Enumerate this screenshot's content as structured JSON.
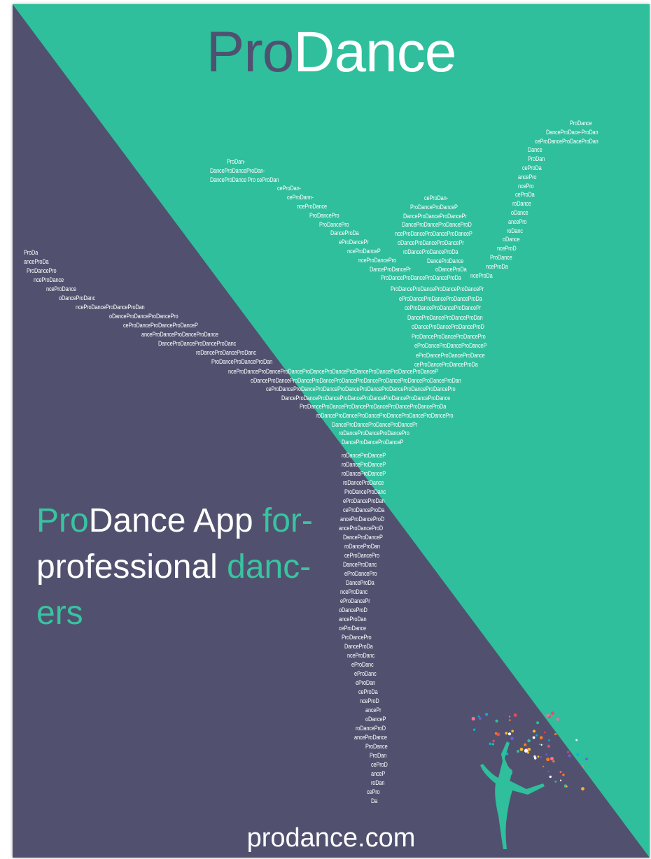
{
  "brand": {
    "part1": "Pro",
    "part2": "Dance"
  },
  "tagline": {
    "line1_a": "Pro",
    "line1_b": "Dance App ",
    "line1_c": "for-",
    "line2_a": "professional ",
    "line2_b": "danc-",
    "line3": "ers"
  },
  "url": "prodance.com",
  "colors": {
    "teal": "#2fbf9c",
    "navy": "#51516f",
    "accent": "#38c4a0"
  },
  "dancer_text": {
    "left_arm": [
      "ProDa",
      "anceProDa",
      "ProDancePro",
      "nceProDance",
      "nceProDance",
      "oDanceProDanc",
      "nceProDanceProDanceProDan",
      "oDanceProDanceProDancePro",
      "ceProDanceProDanceProDanceP",
      "anceProDanceProDanceProDance",
      "DanceProDanceProDanceProDanc",
      "roDanceProDanceProDanc",
      "ProDanceProDanceProDan"
    ],
    "top_arm": [
      "ProDan-",
      "DanceProDanceProDan-",
      "DanceProDance Pro ceProDan",
      "ceProDan-",
      "ceProDann-",
      "nceProDance",
      "ProDancePro",
      "ProDancePro",
      "DanceProDa",
      "eProDancePr",
      "nceProDanceP",
      "nceProDancePro",
      "DanceProDancePr",
      "ProDanceProDanceProDanceProDa"
    ],
    "right_arm": [
      "ProDance",
      "DanceProDace-ProDan",
      "ceProDanceProDaceProDan",
      "Dance",
      "ProDan",
      "ceProDa",
      "ancePro",
      "ncePro",
      "ceProDa",
      "roDance",
      "oDance",
      "ancePro",
      "roDanc",
      "oDance",
      "nceProD",
      "ProDance",
      "nceProDa",
      "nceProDa"
    ],
    "inner_arm": [
      "ceProDan-",
      "ProDanceProDanceP",
      "DanceProDanceProDancePr",
      "DanceProDanceProDanceProD",
      "nceProDanceProDanceProDanceP",
      "oDanceProDanceProDancePr",
      "roDanceProDanceProDa",
      "DanceProDance",
      "oDanceProDa"
    ],
    "torso": [
      "ProDanceProDanceProDanceProDancePr",
      "eProDanceProDanceProDanceProDa",
      "ceProDanceProDanceProDancePr",
      "DanceProDanceProDanceProDan",
      "oDanceProDanceProDanceProD",
      "ProDanceProDanceProDancePro",
      "eProDanceProDanceProDanceP",
      "eProDanceProDanceProDance",
      "ceProDanceProDanceProDa"
    ],
    "hips": [
      "nceProDanceProDanceProDanceProDanceProDanceProDanceProDanceProDanceProDanceP",
      "oDanceProDanceProDanceProDanceProDanceProDanceProDanceProDanceProDanceProDan",
      "ceProDanceProDanceProDanceProDanceProDanceProDanceProDanceProDancePro",
      "DanceProDanceProDanceProDanceProDanceProDanceProDanceProDance",
      "ProDanceProDanceProDanceProDanceProDanceProDanceProDa",
      "roDanceProDanceProDanceProDanceProDanceProDancePro",
      "DanceProDanceProDanceProDancePr",
      "roDanceProDanceProDancePro",
      "DanceProDanceProDanceP"
    ],
    "leg": [
      "roDanceProDanceP",
      "roDanceProDanceP",
      "roDanceProDanceP",
      "roDanceProDance",
      "ProDanceProDanc",
      "eProDanceProDan",
      "ceProDanceProDa",
      "anceProDanceProD",
      "anceProDanceProD",
      "DanceProDanceP",
      "roDanceProDan",
      "ceProDancePro",
      "DanceProDanc",
      "eProDancePro",
      "DanceProDa",
      "nceProDanc",
      "eProDancePr",
      "oDanceProD",
      "anceProDan",
      "ceProDance",
      "ProDancePro",
      "DanceProDa",
      "nceProDanc",
      "eProDanc",
      "eProDanc",
      "eProDan",
      "ceProDa",
      "nceProD",
      "ancePr",
      "oDanceP",
      "roDanceProD",
      "anceProDance",
      "ProDance",
      "ProDan",
      "ceProD",
      "anceP",
      "roDan",
      "cePro",
      "Da"
    ]
  }
}
